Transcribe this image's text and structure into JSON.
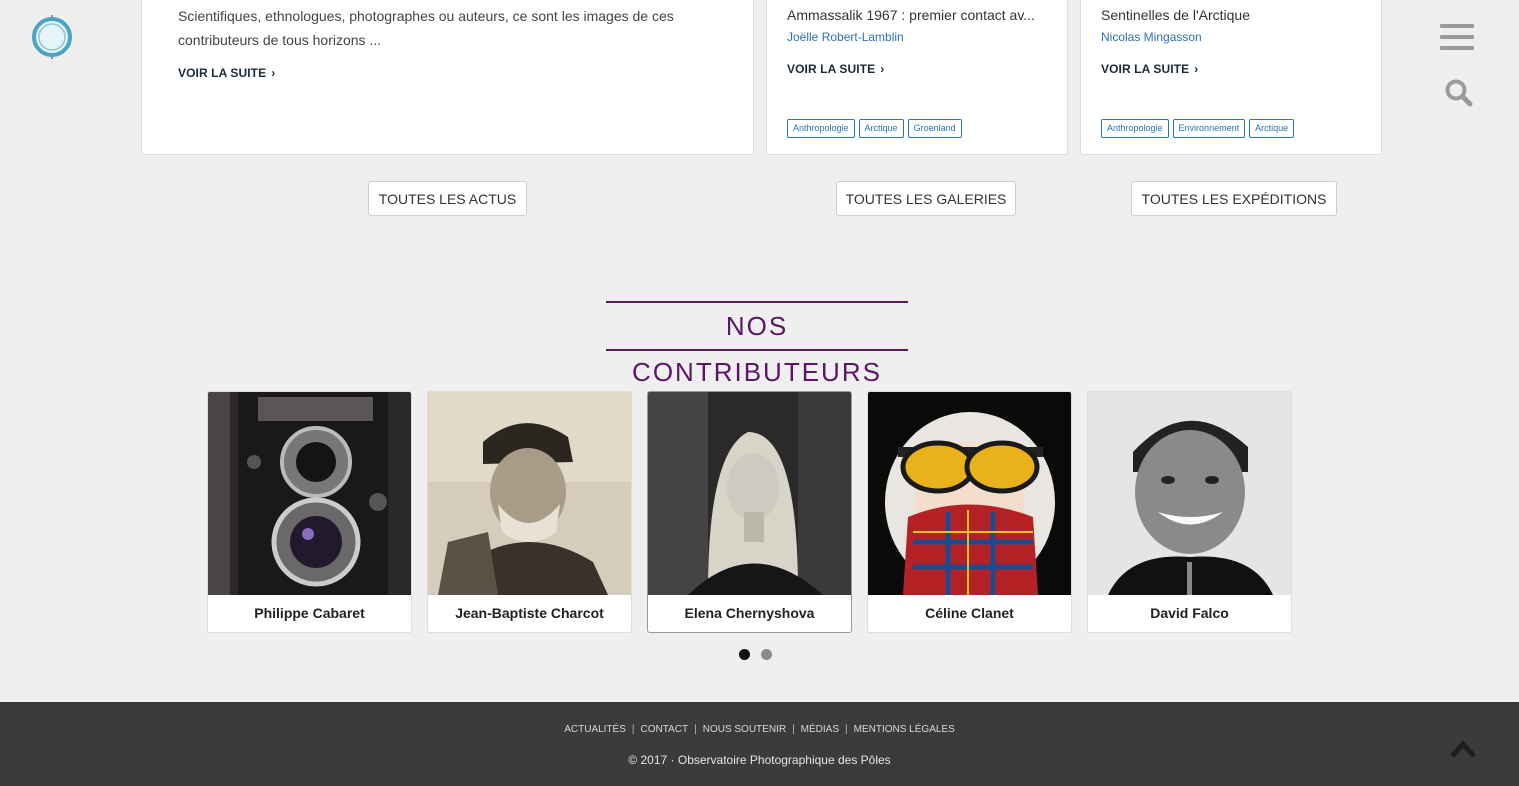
{
  "header": {
    "logo_alt": "Observatoire Photographique des Pôles",
    "menu_icon": "hamburger-menu-icon",
    "search_icon": "search-icon"
  },
  "cards": {
    "card1": {
      "excerpt_line1": "Scientifiques, ethnologues, photographes ou auteurs, ce sont les images de ces",
      "excerpt_line2": "contributeurs de tous horizons ...",
      "read_more": "VOIR LA SUITE"
    },
    "card2": {
      "title": "Ammassalik 1967 : premier contact av...",
      "author": "Joëlle Robert-Lamblin",
      "read_more": "VOIR LA SUITE",
      "tags": [
        "Anthropologie",
        "Arctique",
        "Groenland"
      ]
    },
    "card3": {
      "title": "Sentinelles de l'Arctique",
      "author": "Nicolas Mingasson",
      "read_more": "VOIR LA SUITE",
      "tags": [
        "Anthropologie",
        "Environnement",
        "Arctique"
      ]
    }
  },
  "buttons": {
    "actus": "TOUTES LES ACTUS",
    "galeries": "TOUTES LES GALERIES",
    "expeditions": "TOUTES LES EXPÉDITIONS"
  },
  "contributors": {
    "title": "NOS CONTRIBUTEURS",
    "items": [
      {
        "name": "Philippe Cabaret"
      },
      {
        "name": "Jean-Baptiste Charcot"
      },
      {
        "name": "Elena Chernyshova"
      },
      {
        "name": "Céline Clanet"
      },
      {
        "name": "David Falco"
      }
    ],
    "pagination": {
      "current": 1,
      "total": 2
    }
  },
  "footer": {
    "links": [
      "ACTUALITÉS",
      "CONTACT",
      "NOUS SOUTENIR",
      "MÉDIAS",
      "MENTIONS LÉGALES"
    ],
    "separator": "|",
    "copyright": "© 2017 · Observatoire Photographique des Pôles"
  },
  "colors": {
    "accent": "#5b1666",
    "link": "#2a73b8",
    "footer_bg": "#3b3b3b",
    "page_bg": "#efefef"
  }
}
